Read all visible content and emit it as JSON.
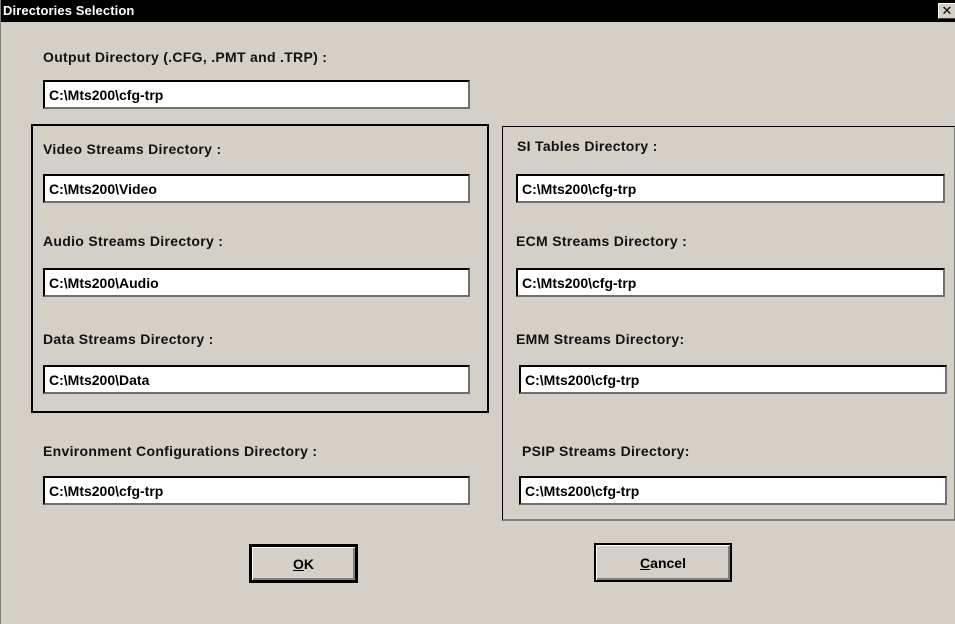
{
  "window": {
    "title": "Directories Selection",
    "close_glyph": "✕"
  },
  "output": {
    "label": "Output Directory (.CFG, .PMT and .TRP) :",
    "value": "C:\\Mts200\\cfg-trp"
  },
  "video": {
    "label": "Video Streams Directory :",
    "value": "C:\\Mts200\\Video"
  },
  "audio": {
    "label": "Audio Streams Directory :",
    "value": "C:\\Mts200\\Audio"
  },
  "data_streams": {
    "label": "Data Streams Directory :",
    "value": "C:\\Mts200\\Data"
  },
  "environment": {
    "label": "Environment Configurations Directory :",
    "value": "C:\\Mts200\\cfg-trp"
  },
  "si_tables": {
    "label": "SI Tables Directory :",
    "value": "C:\\Mts200\\cfg-trp"
  },
  "ecm": {
    "label": "ECM Streams Directory :",
    "value": "C:\\Mts200\\cfg-trp"
  },
  "emm": {
    "label": "EMM Streams Directory:",
    "value": "C:\\Mts200\\cfg-trp"
  },
  "psip": {
    "label": "PSIP Streams Directory:",
    "value": "C:\\Mts200\\cfg-trp"
  },
  "buttons": {
    "ok_mnemonic": "O",
    "ok_rest": "K",
    "cancel_mnemonic": "C",
    "cancel_rest": "ancel"
  }
}
